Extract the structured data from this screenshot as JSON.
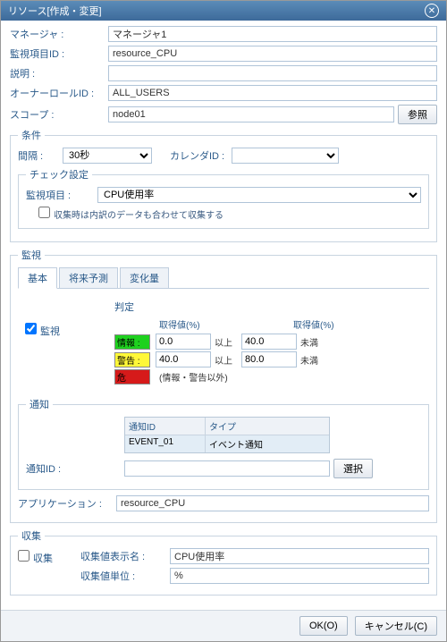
{
  "title": "リソース[作成・変更]",
  "fields": {
    "manager": {
      "label": "マネージャ :",
      "value": "マネージャ1"
    },
    "monitorId": {
      "label": "監視項目ID :",
      "value": "resource_CPU"
    },
    "description": {
      "label": "説明 :",
      "value": ""
    },
    "ownerRole": {
      "label": "オーナーロールID :",
      "value": "ALL_USERS"
    },
    "scope": {
      "label": "スコープ :",
      "value": "node01",
      "refBtn": "参照"
    }
  },
  "condition": {
    "legend": "条件",
    "interval": {
      "label": "間隔 :",
      "value": "30秒"
    },
    "calendar": {
      "label": "カレンダID :",
      "value": ""
    },
    "check": {
      "legend": "チェック設定",
      "monitorItem": {
        "label": "監視項目 :",
        "value": "CPU使用率"
      },
      "note": "収集時は内訳のデータも合わせて収集する"
    }
  },
  "monitor": {
    "legend": "監視",
    "tabs": [
      "基本",
      "将来予測",
      "変化量"
    ],
    "checkbox": "監視",
    "judge": {
      "title": "判定",
      "col1": "取得値(%)",
      "col2": "取得値(%)",
      "rows": [
        {
          "color": "g",
          "label": "情報 :",
          "v1": "0.0",
          "a1": "以上",
          "v2": "40.0",
          "a2": "未満"
        },
        {
          "color": "y",
          "label": "警告 :",
          "v1": "40.0",
          "a1": "以上",
          "v2": "80.0",
          "a2": "未満"
        },
        {
          "color": "r",
          "label": "危",
          "note": "(情報・警告以外)"
        }
      ]
    },
    "notify": {
      "legend": "通知",
      "thead": [
        "通知ID",
        "タイプ"
      ],
      "trow": [
        "EVENT_01",
        "イベント通知"
      ],
      "idLabel": "通知ID :",
      "selectBtn": "選択"
    },
    "app": {
      "label": "アプリケーション :",
      "value": "resource_CPU"
    }
  },
  "collect": {
    "legend": "収集",
    "checkbox": "収集",
    "displayName": {
      "label": "収集値表示名 :",
      "value": "CPU使用率"
    },
    "unit": {
      "label": "収集値単位 :",
      "value": "%"
    }
  },
  "footer": {
    "ok": "OK(O)",
    "cancel": "キャンセル(C)"
  }
}
